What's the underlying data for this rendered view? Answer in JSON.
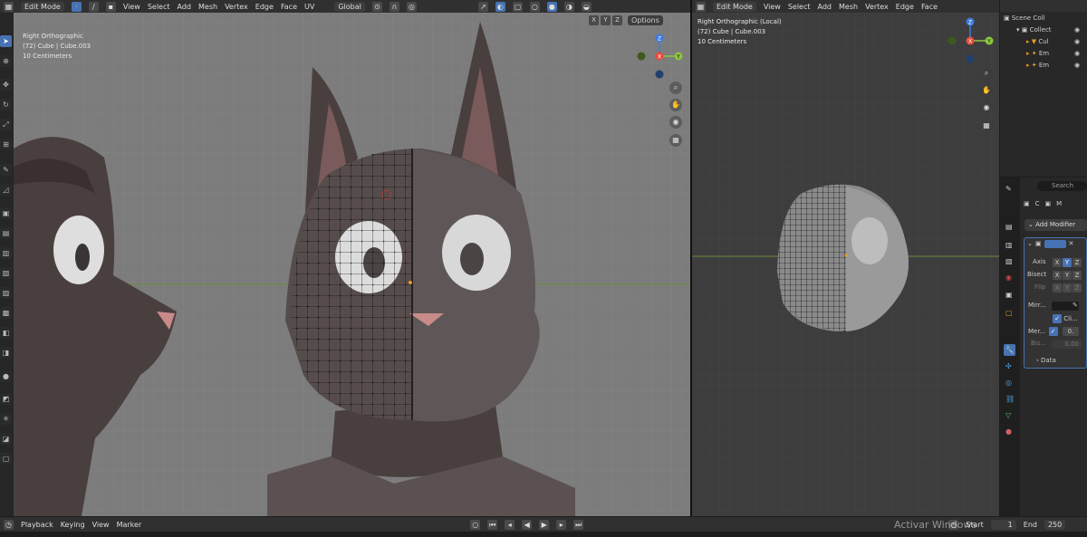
{
  "left_header": {
    "mode": "Edit Mode",
    "menus": [
      "View",
      "Select",
      "Add",
      "Mesh",
      "Vertex",
      "Edge",
      "Face",
      "UV"
    ],
    "orientation": "Global"
  },
  "left_overlay": {
    "line1": "Right Orthographic",
    "line2": "(72) Cube | Cube.003",
    "line3": "10 Centimeters",
    "axes": [
      "X",
      "Y",
      "Z"
    ],
    "options": "Options"
  },
  "right_header": {
    "mode": "Edit Mode",
    "menus": [
      "View",
      "Select",
      "Add",
      "Mesh",
      "Vertex",
      "Edge",
      "Face"
    ]
  },
  "right_overlay": {
    "line1": "Right Orthographic (Local)",
    "line2": "(72) Cube | Cube.003",
    "line3": "10 Centimeters"
  },
  "gizmo": {
    "x": "X",
    "y": "Y",
    "z": "Z",
    "color_x": "#e74c3c",
    "color_y": "#8cc63f",
    "color_z": "#3d7be0"
  },
  "outliner": {
    "title": "Scene Coll",
    "collection": "Collect",
    "items": [
      "Cul",
      "Em",
      "Em"
    ]
  },
  "properties": {
    "search": "Search",
    "tab_a": "C",
    "tab_b": "M",
    "add_modifier": "Add Modifier",
    "axis": "Axis",
    "bisect": "Bisect",
    "flip": "Flip",
    "mirror": "Mirr...",
    "clip": "Cli...",
    "merge": "Mer...",
    "merge_val": "0.",
    "bisect_dist": "Bis...",
    "bisect_val": "0.00",
    "data": "Data",
    "x": "X",
    "y": "Y",
    "z": "Z"
  },
  "timeline": {
    "playback": "Playback",
    "keying": "Keying",
    "view": "View",
    "marker": "Marker",
    "start_label": "Start",
    "start": "1",
    "end_label": "End",
    "end": "250"
  },
  "watermark": "Activar Windows",
  "accent": "#4772b3"
}
